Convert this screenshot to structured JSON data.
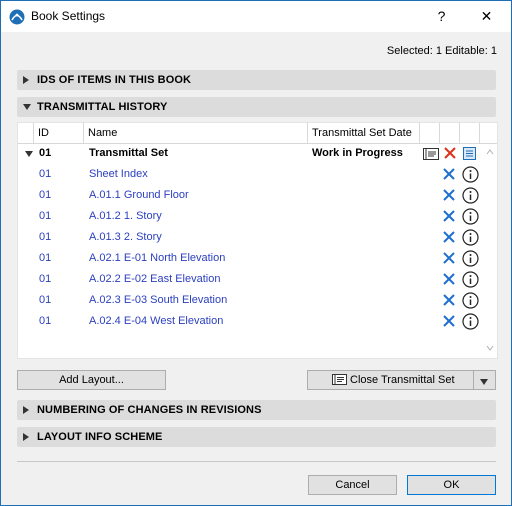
{
  "window": {
    "title": "Book Settings",
    "help_label": "?",
    "close_label": "✕"
  },
  "status": "Selected: 1 Editable: 1",
  "sections": {
    "ids": "IDS OF ITEMS IN THIS BOOK",
    "transmittal": "TRANSMITTAL HISTORY",
    "numbering": "NUMBERING OF CHANGES IN REVISIONS",
    "layout_info": "LAYOUT INFO SCHEME"
  },
  "table": {
    "headers": {
      "id": "ID",
      "name": "Name",
      "date": "Transmittal Set Date"
    },
    "group": {
      "id": "01",
      "name": "Transmittal Set",
      "date": "Work in Progress"
    },
    "rows": [
      {
        "id": "01",
        "name": "Sheet Index"
      },
      {
        "id": "01",
        "name": "A.01.1 Ground Floor"
      },
      {
        "id": "01",
        "name": "A.01.2 1. Story"
      },
      {
        "id": "01",
        "name": "A.01.3 2. Story"
      },
      {
        "id": "01",
        "name": "A.02.1 E-01 North Elevation"
      },
      {
        "id": "01",
        "name": "A.02.2 E-02 East Elevation"
      },
      {
        "id": "01",
        "name": "A.02.3 E-03 South Elevation"
      },
      {
        "id": "01",
        "name": "A.02.4 E-04 West Elevation"
      }
    ]
  },
  "buttons": {
    "add_layout": "Add Layout...",
    "close_transmittal": "Close Transmittal Set",
    "cancel": "Cancel",
    "ok": "OK"
  },
  "colors": {
    "accent": "#1e6fb5",
    "link_text": "#2b3fbf",
    "delete_red": "#e0301e",
    "section_bg": "#dcdcdc"
  }
}
